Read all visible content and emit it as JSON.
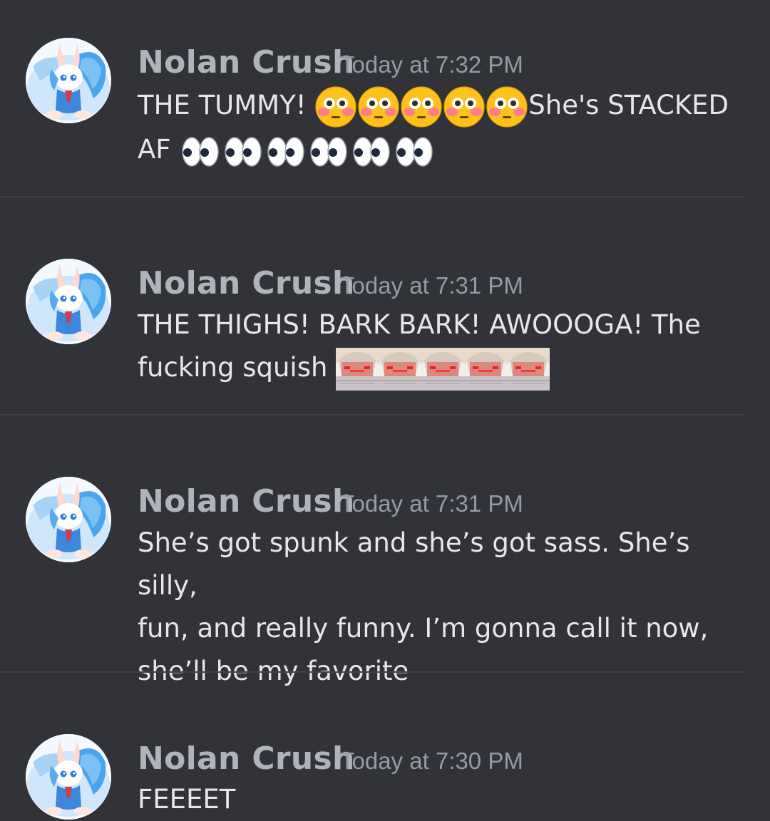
{
  "messages": [
    {
      "author": "Nolan Crush",
      "timestamp": "Today at 7:32 PM",
      "text_before": "THE TUMMY! ",
      "emoji_1": {
        "name": "flushed-face",
        "count": 5
      },
      "text_middle": "She's STACKED",
      "text_line2": "AF ",
      "emoji_2": {
        "name": "eyes",
        "count": 6
      }
    },
    {
      "author": "Nolan Crush",
      "timestamp": "Today at 7:31 PM",
      "text_line1": "THE THIGHS! BARK BARK! AWOOOGA! The",
      "text_line2": "fucking squish ",
      "emoji": {
        "name": "custom-anime-red-eyes-emoji",
        "count": 5
      }
    },
    {
      "author": "Nolan Crush",
      "timestamp": "Today at 7:31 PM",
      "line1": "She’s got spunk and she’s got sass. She’s silly,",
      "line2": "fun, and really funny. I’m gonna call it now,",
      "line3": "she’ll be my favorite"
    },
    {
      "author": "Nolan Crush",
      "timestamp": "Today at 7:30 PM",
      "text": "FEEEET"
    }
  ],
  "colors": {
    "background": "#313338",
    "username": "#b0b3b9",
    "timestamp": "#949ba4",
    "text": "#e6e7e9",
    "divider": "#3f4147"
  }
}
